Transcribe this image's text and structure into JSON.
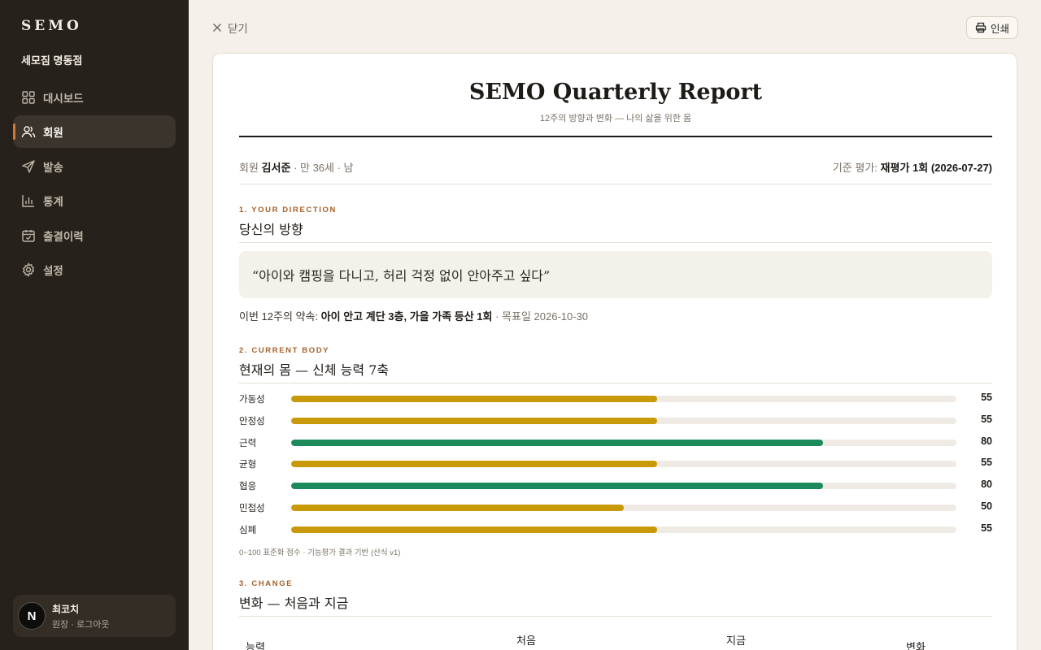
{
  "sidebar": {
    "brand": "SEMO",
    "store": "세모짐 명동점",
    "items": [
      {
        "label": "대시보드",
        "icon": "grid-icon"
      },
      {
        "label": "회원",
        "icon": "users-icon",
        "active": true
      },
      {
        "label": "발송",
        "icon": "send-icon"
      },
      {
        "label": "통계",
        "icon": "bar-chart-icon"
      },
      {
        "label": "출결이력",
        "icon": "calendar-check-icon"
      },
      {
        "label": "설정",
        "icon": "gear-icon"
      }
    ],
    "user": {
      "avatar": "N",
      "name": "최코치",
      "role": "원장 · 로그아웃"
    }
  },
  "topbar": {
    "close_label": "닫기",
    "print_label": "인쇄"
  },
  "report": {
    "title": "SEMO Quarterly Report",
    "subtitle": "12주의 방향과 변화 — 나의 삶을 위한 몸",
    "member_prefix": "회원",
    "member_name": "김서준",
    "member_info": "· 만 36세 · 남",
    "basis_prefix": "기준 평가:",
    "basis_value": "재평가 1회 (2026-07-27)",
    "sections": {
      "direction": {
        "kicker": "1. YOUR DIRECTION",
        "title": "당신의 방향",
        "quote": "“아이와 캠핑을 다니고, 허리 걱정 없이 안아주고 싶다”",
        "promise_prefix": "이번 12주의 약속:",
        "promise_value": "아이 안고 계단 3층, 가을 가족 등산 1회",
        "promise_due": "· 목표일 2026-10-30"
      },
      "body": {
        "kicker": "2. CURRENT BODY",
        "title": "현재의 몸 — 신체 능력 7축",
        "note": "0~100 표준화 점수 · 기능평가 결과 기반 (산식 v1)"
      },
      "change": {
        "kicker": "3. CHANGE",
        "title": "변화 — 처음과 지금",
        "columns": [
          "능력",
          "처음",
          "지금",
          "변화"
        ]
      }
    }
  },
  "colors": {
    "bar_mid": "#c89a0a",
    "bar_high": "#1c8a5a"
  },
  "body_scores": [
    {
      "label": "가동성",
      "value": 55
    },
    {
      "label": "안정성",
      "value": 55
    },
    {
      "label": "근력",
      "value": 80
    },
    {
      "label": "균형",
      "value": 55
    },
    {
      "label": "협응",
      "value": 80
    },
    {
      "label": "민첩성",
      "value": 50
    },
    {
      "label": "심폐",
      "value": 55
    }
  ]
}
